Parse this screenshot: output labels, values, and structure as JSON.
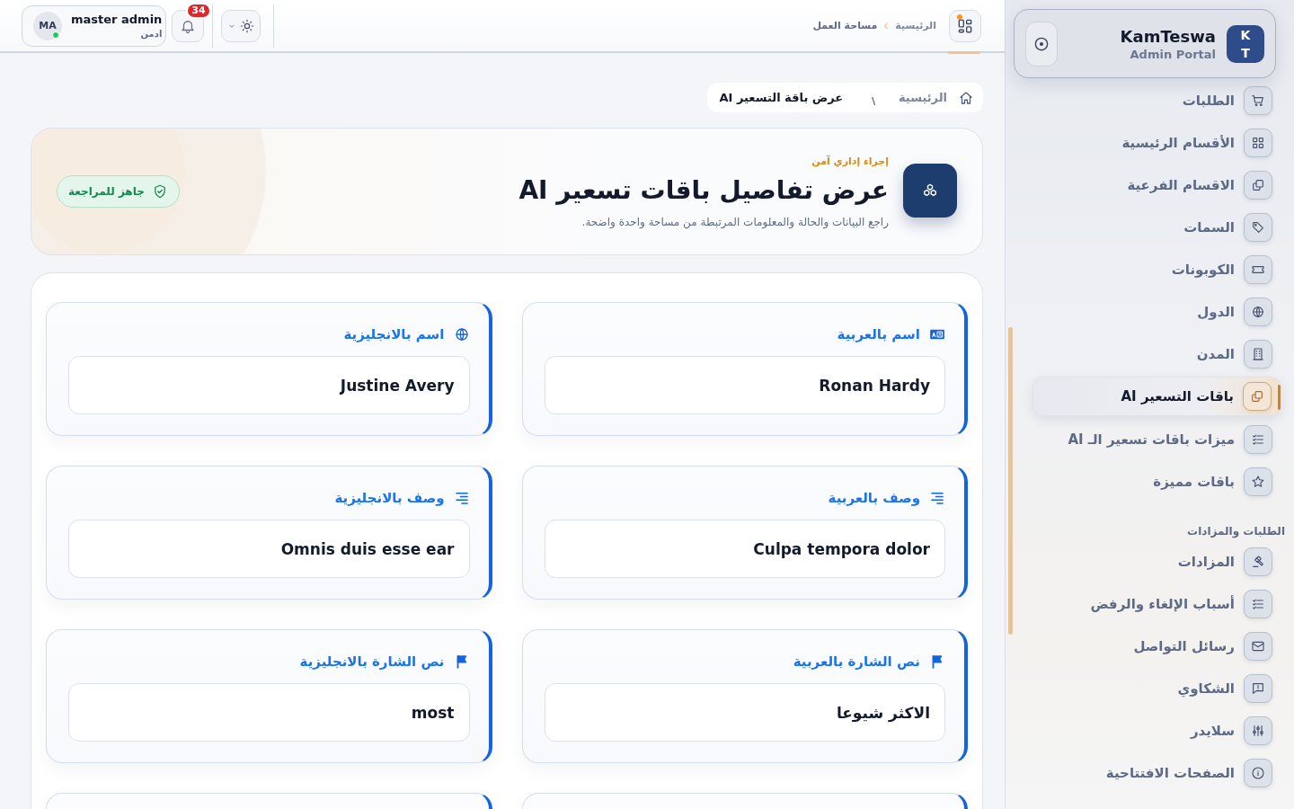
{
  "topbar": {
    "user": {
      "initials": "MA",
      "name": "master admin",
      "role": "ادمن",
      "online": true
    },
    "notifications": {
      "count": "34"
    },
    "breadcrumb": [
      "الرئيسية",
      "مساحة العمل"
    ]
  },
  "sidebar": {
    "brand": {
      "logo": [
        "K",
        "T"
      ],
      "name": "KamTeswa",
      "subtitle": "Admin Portal"
    },
    "items": [
      {
        "kind": "item",
        "label": "الطلبات",
        "selected": false
      },
      {
        "kind": "item",
        "label": "الأقسام الرئيسية",
        "selected": false
      },
      {
        "kind": "item",
        "label": "الاقسام الفرعية",
        "selected": false
      },
      {
        "kind": "item",
        "label": "السمات",
        "selected": false
      },
      {
        "kind": "item",
        "label": "الكوبونات",
        "selected": false
      },
      {
        "kind": "item",
        "label": "الدول",
        "selected": false
      },
      {
        "kind": "item",
        "label": "المدن",
        "selected": false
      },
      {
        "kind": "item",
        "label": "باقات التسعير AI",
        "selected": true
      },
      {
        "kind": "item",
        "label": "ميزات باقات تسعير الـ AI",
        "selected": false
      },
      {
        "kind": "item",
        "label": "باقات مميزة",
        "selected": false
      },
      {
        "kind": "heading",
        "label": "الطلبات والمزادات"
      },
      {
        "kind": "item",
        "label": "المزادات",
        "selected": false
      },
      {
        "kind": "item",
        "label": "أسباب الإلغاء والرفض",
        "selected": false
      },
      {
        "kind": "item",
        "label": "رسائل التواصل",
        "selected": false
      },
      {
        "kind": "item",
        "label": "الشكاوي",
        "selected": false
      },
      {
        "kind": "item",
        "label": "سلايدر",
        "selected": false
      },
      {
        "kind": "item",
        "label": "الصفحات الافتتاحية",
        "selected": false
      }
    ]
  },
  "breadcrumb": [
    "الرئيسية",
    "\\",
    "عرض باقة التسعير AI"
  ],
  "hero": {
    "eyebrow": "إجراء إداري آمن",
    "title": "عرض تفاصيل باقات تسعير AI",
    "subtitle": "راجع البيانات والحالة والمعلومات المرتبطة من مساحة واحدة واضحة.",
    "badge": "جاهز للمراجعة"
  },
  "fields": [
    {
      "label": "اسم بالعربية",
      "value": "Ronan Hardy"
    },
    {
      "label": "اسم بالانجليزية",
      "value": "Justine Avery"
    },
    {
      "label": "وصف بالعربية",
      "value": "Culpa tempora dolor"
    },
    {
      "label": "وصف بالانجليزية",
      "value": "Omnis duis esse ear"
    },
    {
      "label": "نص الشارة بالعربية",
      "value": "الاكثر شيوعا"
    },
    {
      "label": "نص الشارة بالانجليزية",
      "value": "most"
    }
  ]
}
